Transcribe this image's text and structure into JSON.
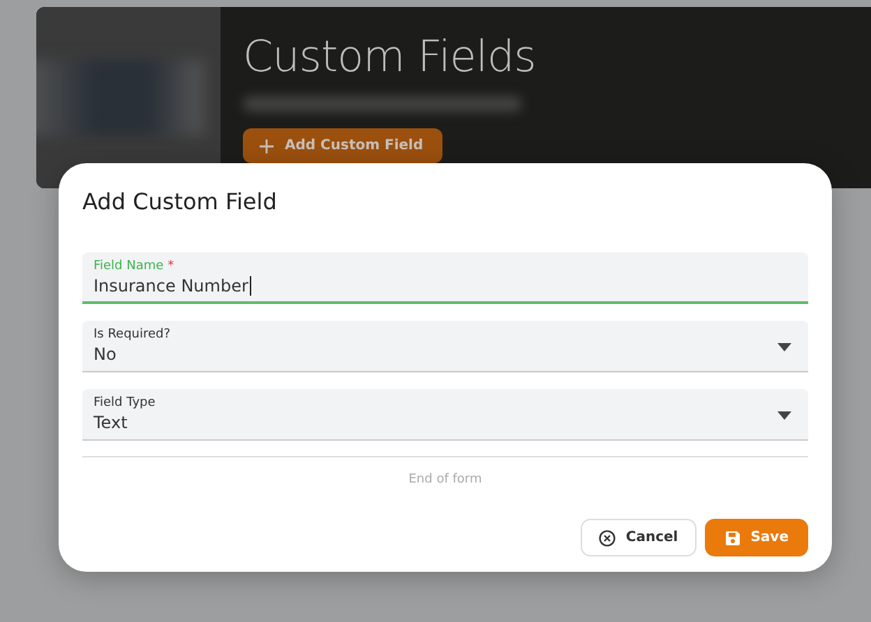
{
  "page": {
    "title": "Custom Fields",
    "add_button": "Add Custom Field"
  },
  "dialog": {
    "title": "Add Custom Field",
    "fields": [
      {
        "kind": "text",
        "label": "Field Name",
        "required_mark": "*",
        "focused": true,
        "value": "Insurance Number"
      },
      {
        "kind": "select",
        "label": "Is Required?",
        "focused": false,
        "value": "No"
      },
      {
        "kind": "select",
        "label": "Field Type",
        "focused": false,
        "value": "Text"
      }
    ],
    "end_note": "End of form",
    "buttons": [
      {
        "kind": "cancel",
        "label": "Cancel"
      },
      {
        "kind": "save",
        "label": "Save"
      }
    ]
  }
}
